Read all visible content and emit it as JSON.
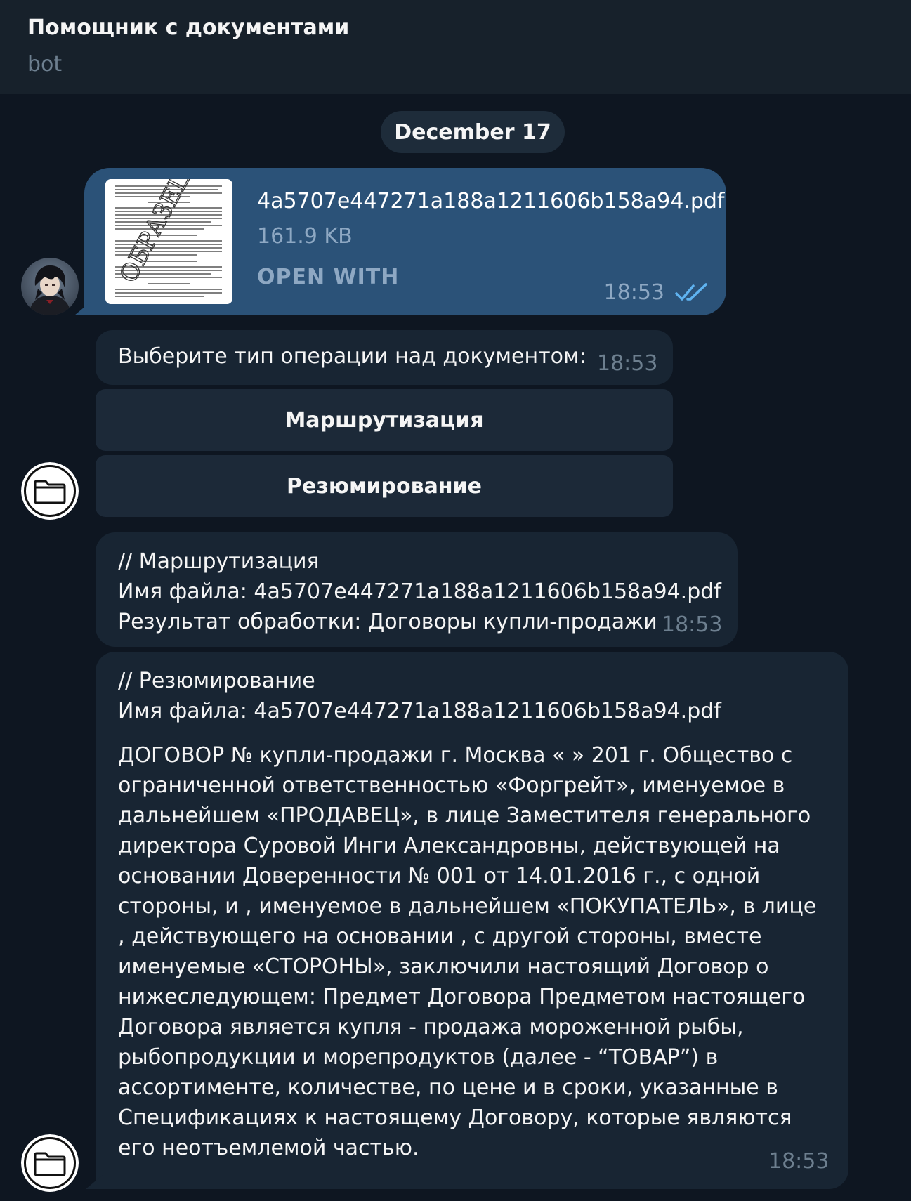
{
  "header": {
    "title": "Помощник с документами",
    "subtitle": "bot"
  },
  "date_separator": "December 17",
  "file_message": {
    "file_name": "4a5707e447271a188a1211606b158a94.pdf",
    "file_size": "161.9 KB",
    "open_with_label": "OPEN WITH",
    "time": "18:53",
    "thumbnail_stamp": "ОБРАЗЕЦ"
  },
  "prompt_message": {
    "text": "Выберите тип операции над документом:",
    "time": "18:53",
    "buttons": [
      {
        "label": "Маршрутизация"
      },
      {
        "label": "Резюмирование"
      }
    ]
  },
  "routing_message": {
    "lines": [
      "// Маршрутизация",
      "Имя файла: 4a5707e447271a188a1211606b158a94.pdf",
      "Результат обработки: Договоры купли-продажи"
    ],
    "time": "18:53"
  },
  "summary_message": {
    "header_lines": [
      "// Резюмирование",
      "Имя файла: 4a5707e447271a188a1211606b158a94.pdf"
    ],
    "body": "ДОГОВОР № купли-продажи г. Москва « » 201 г. Общество с ограниченной ответственностью «Форгрейт», именуемое в дальнейшем «ПРОДАВЕЦ», в лице Заместителя генерального директора Суровой Инги Александровны, действующей на основании Доверенности № 001 от 14.01.2016 г., с одной стороны, и , именуемое в дальнейшем «ПОКУПАТЕЛЬ», в лице , действующего на основании , с другой стороны, вместе именуемые «СТОРОНЫ», заключили настоящий Договор о нижеследующем: Предмет Договора Предметом настоящего Договора является купля - продажа мороженной рыбы, рыбопродукции и морепродуктов (далее - “ТОВАР”) в ассортименте, количестве, по цене и в сроки, указанные в Спецификациях к настоящему Договору, которые являются его неотъемлемой частью.",
    "time": "18:53"
  },
  "colors": {
    "background": "#0e1621",
    "header": "#17212b",
    "outgoing_bubble": "#2b5278",
    "incoming_bubble": "#182533",
    "keyboard_button": "#1c2938",
    "accent_text": "#8ea8c3",
    "read_checks": "#5fb3f0"
  },
  "icons": {
    "user_avatar": "anime-avatar-icon",
    "bot_avatar": "folder-icon",
    "read_status": "double-check-icon"
  }
}
